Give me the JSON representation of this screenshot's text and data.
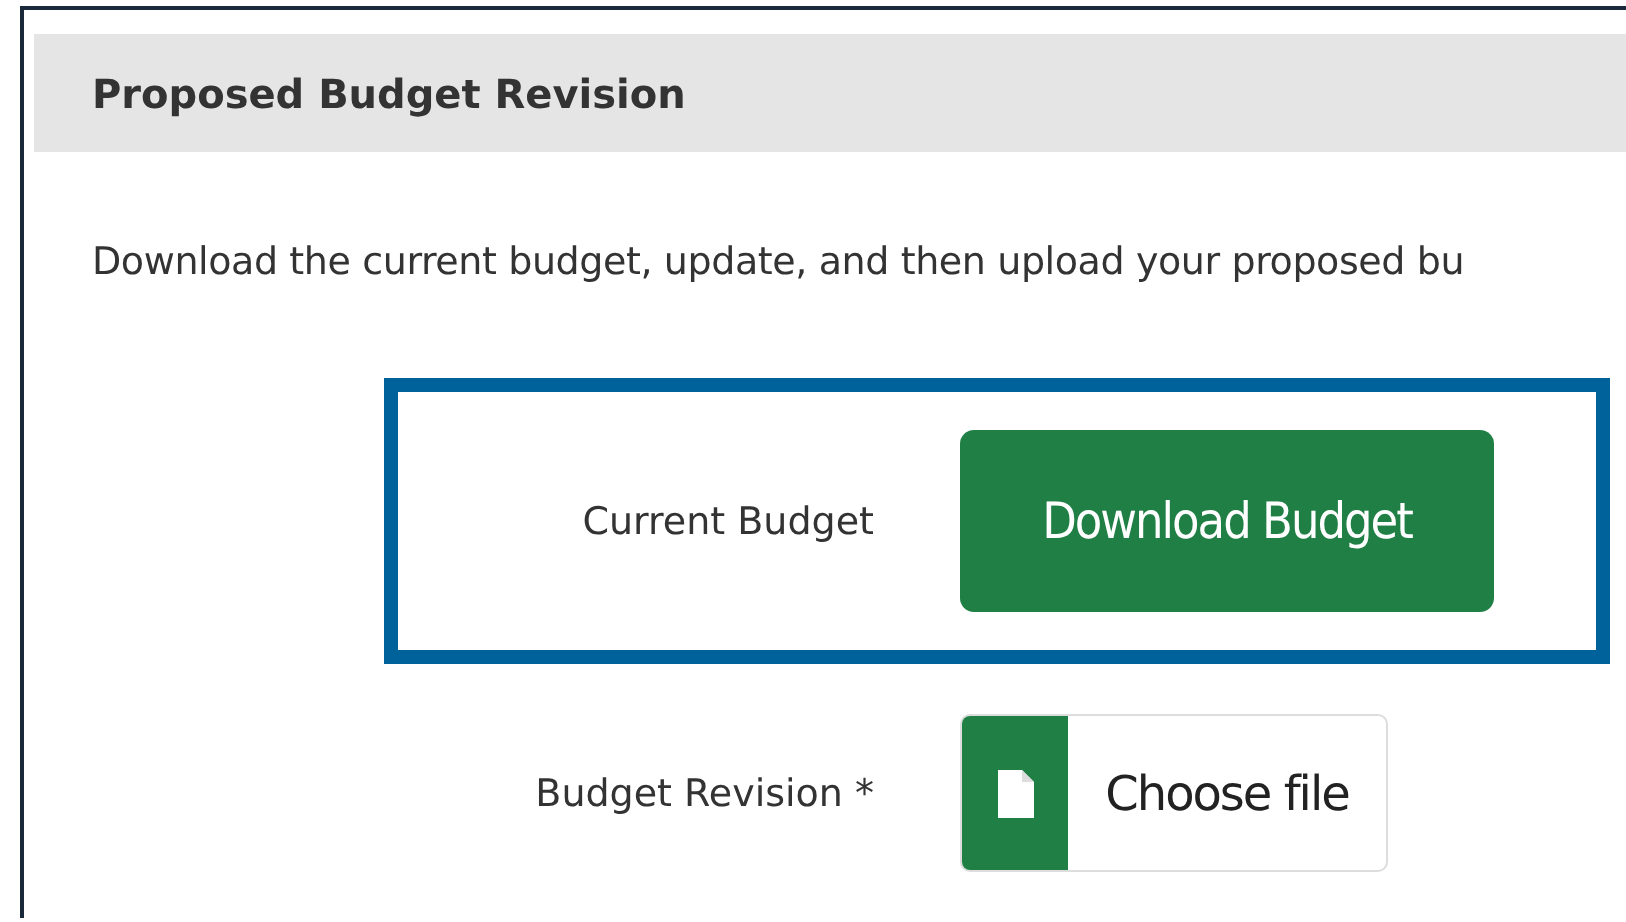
{
  "panel": {
    "title": "Proposed Budget Revision",
    "description": "Download the current budget, update, and then upload your proposed bu",
    "rows": [
      {
        "kind": "button",
        "label": "Current Budget",
        "control": "Download Budget",
        "highlighted": true
      },
      {
        "kind": "file",
        "label": "Budget Revision *",
        "control": "Choose file",
        "highlighted": false
      }
    ]
  }
}
